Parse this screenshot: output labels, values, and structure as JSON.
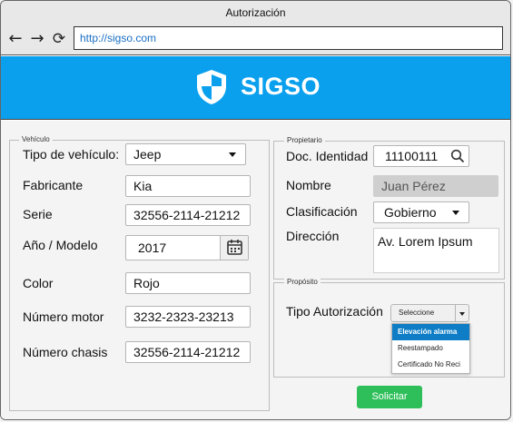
{
  "window": {
    "title": "Autorización"
  },
  "browser": {
    "url": "http://sigso.com"
  },
  "app": {
    "brand": "SIGSO",
    "accent_color": "#0aa0ee",
    "logo_icon": "shield-icon"
  },
  "vehicle": {
    "legend": "Vehículo",
    "type_label": "Tipo de vehículo:",
    "type_value": "Jeep",
    "manufacturer_label": "Fabricante",
    "manufacturer_value": "Kia",
    "serial_label": "Serie",
    "serial_value": "32556-2114-21212",
    "year_label": "Año / Modelo",
    "year_value": "2017",
    "color_label": "Color",
    "color_value": "Rojo",
    "motor_label": "Número motor",
    "motor_value": "3232-2323-23213",
    "chassis_label": "Número chasis",
    "chassis_value": "32556-2114-21212"
  },
  "owner": {
    "legend": "Propietario",
    "id_label": "Doc. Identidad",
    "id_value": "11100111",
    "name_label": "Nombre",
    "name_value": "Juan Pérez",
    "class_label": "Clasificación",
    "class_value": "Gobierno",
    "address_label": "Dirección",
    "address_value": "Av. Lorem Ipsum"
  },
  "purpose": {
    "legend": "Propósito",
    "type_label": "Tipo Autorización",
    "select_placeholder": "Seleccione",
    "options": [
      "Elevación alarma",
      "Reestampado",
      "Certificado No Reci"
    ]
  },
  "actions": {
    "submit_label": "Solicitar",
    "submit_color": "#2fbf5a"
  }
}
